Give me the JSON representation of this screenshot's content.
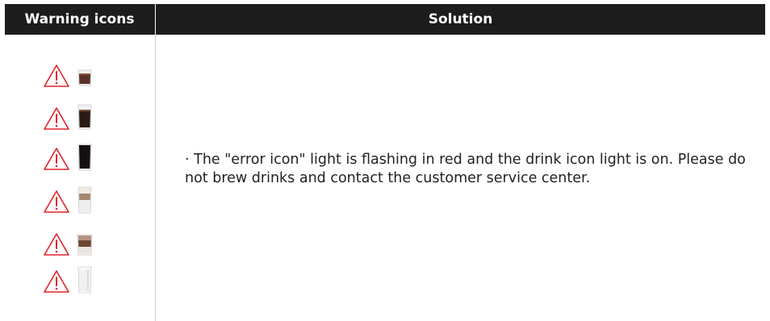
{
  "table": {
    "header": {
      "warning_icons_label": "Warning icons",
      "solution_label": "Solution"
    },
    "rows": [
      {
        "warning_icon": "warning-triangle-icon",
        "drink": "espresso-small-cup"
      },
      {
        "warning_icon": "warning-triangle-icon",
        "drink": "coffee-tall-cup"
      },
      {
        "warning_icon": "warning-triangle-icon",
        "drink": "americano-tall-cup"
      },
      {
        "warning_icon": "warning-triangle-icon",
        "drink": "latte-macchiato-tall-cup"
      },
      {
        "warning_icon": "warning-triangle-icon",
        "drink": "cappuccino-cup"
      },
      {
        "warning_icon": "warning-triangle-icon",
        "drink": "milk-glass"
      }
    ],
    "solution_text": "· The \"error icon\" light is flashing in red and the drink icon light is on. Please do not brew drinks and contact the customer service center."
  },
  "colors": {
    "header_bg": "#1d1d1d",
    "header_text": "#ffffff",
    "warning_red": "#e2232a",
    "body_text": "#222222"
  }
}
